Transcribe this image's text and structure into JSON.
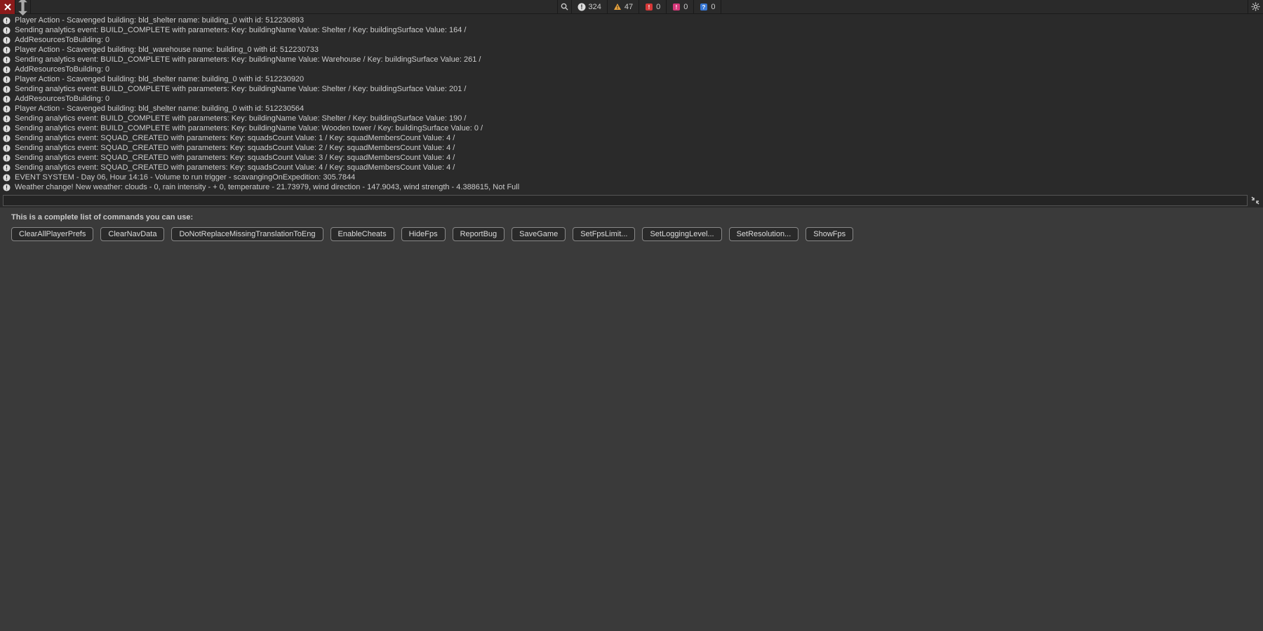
{
  "toolbar": {
    "counters": {
      "info": "324",
      "warn": "47",
      "error": "0",
      "error2": "0",
      "question": "0"
    }
  },
  "log": [
    "Player Action - Scavenged building: bld_shelter name: building_0 with id: 512230893",
    "Sending analytics event: BUILD_COMPLETE with parameters: Key: buildingName Value: Shelter / Key: buildingSurface Value: 164 /",
    "AddResourcesToBuilding: 0",
    "Player Action - Scavenged building: bld_warehouse name: building_0 with id: 512230733",
    "Sending analytics event: BUILD_COMPLETE with parameters: Key: buildingName Value: Warehouse / Key: buildingSurface Value: 261 /",
    "AddResourcesToBuilding: 0",
    "Player Action - Scavenged building: bld_shelter name: building_0 with id: 512230920",
    "Sending analytics event: BUILD_COMPLETE with parameters: Key: buildingName Value: Shelter / Key: buildingSurface Value: 201 /",
    "AddResourcesToBuilding: 0",
    "Player Action - Scavenged building: bld_shelter name: building_0 with id: 512230564",
    "Sending analytics event: BUILD_COMPLETE with parameters: Key: buildingName Value: Shelter / Key: buildingSurface Value: 190 /",
    "Sending analytics event: BUILD_COMPLETE with parameters: Key: buildingName Value: Wooden tower / Key: buildingSurface Value: 0 /",
    "Sending analytics event: SQUAD_CREATED with parameters: Key: squadsCount Value: 1 / Key: squadMembersCount Value: 4 /",
    "Sending analytics event: SQUAD_CREATED with parameters: Key: squadsCount Value: 2 / Key: squadMembersCount Value: 4 /",
    "Sending analytics event: SQUAD_CREATED with parameters: Key: squadsCount Value: 3 / Key: squadMembersCount Value: 4 /",
    "Sending analytics event: SQUAD_CREATED with parameters: Key: squadsCount Value: 4 / Key: squadMembersCount Value: 4 /",
    "EVENT SYSTEM - Day 06, Hour 14:16 - Volume to run trigger - scavangingOnExpedition: 305.7844",
    "Weather change! New weather: clouds - 0, rain intensity -  + 0, temperature - 21.73979, wind direction - 147.9043, wind strength - 4.388615, Not Full"
  ],
  "commands": {
    "label": "This is a complete list of commands you can use:",
    "items": [
      "ClearAllPlayerPrefs",
      "ClearNavData",
      "DoNotReplaceMissingTranslationToEng",
      "EnableCheats",
      "HideFps",
      "ReportBug",
      "SaveGame",
      "SetFpsLimit...",
      "SetLoggingLevel...",
      "SetResolution...",
      "ShowFps"
    ]
  },
  "input": {
    "value": ""
  }
}
